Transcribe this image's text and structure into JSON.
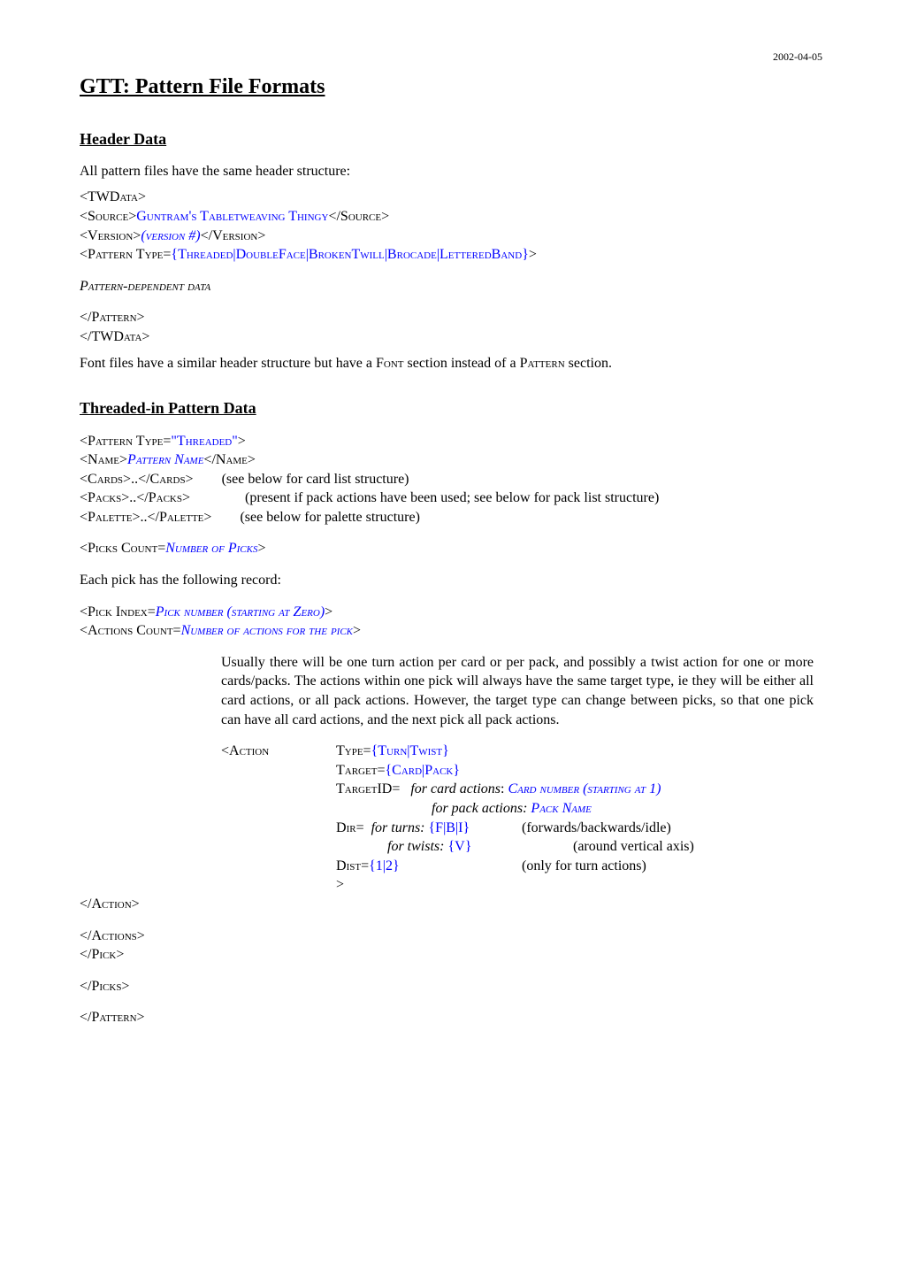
{
  "date": "2002-04-05",
  "title": "GTT: Pattern File Formats",
  "s1": {
    "heading": "Header Data",
    "intro": "All pattern files have the same header structure:",
    "twdata_open": "<TWD",
    "twdata_open2": "ata>",
    "source_open": "<S",
    "source_open2": "ource>",
    "source_val": "Guntram's Tabletweaving Thingy",
    "source_close": "</S",
    "source_close2": "ource>",
    "version_open": "<V",
    "version_open2": "ersion>",
    "version_val": "(version #)",
    "version_close": "</V",
    "version_close2": "ersion>",
    "pattern_open": "<P",
    "pattern_open2": "attern T",
    "pattern_open3": "ype=",
    "pattern_types": "{Threaded|DoubleFace|BrokenTwill|Brocade|LetteredBand}",
    "pdd": "Pattern-dependent data",
    "pattern_close": "</P",
    "pattern_close2": "attern>",
    "twdata_close": "</TWD",
    "twdata_close2": "ata>",
    "font_note_1": "Font files have a similar header structure but have a F",
    "font_note_2": "ont",
    "font_note_3": " section instead of a P",
    "font_note_4": "attern",
    "font_note_5": " section."
  },
  "s2": {
    "heading": "Threaded-in Pattern Data",
    "pattern_open": "<P",
    "pattern_open2": "attern T",
    "pattern_open3": "ype=",
    "pattern_type_val": "\"Threaded\"",
    "name_open": "<N",
    "name_open2": "ame>",
    "name_val": "Pattern Name",
    "name_close": "</N",
    "name_close2": "ame>",
    "cards_open": "<C",
    "cards_open2": "ards>..</C",
    "cards_open3": "ards>",
    "cards_comment": "(see below for card list structure)",
    "packs_open": "<P",
    "packs_open2": "acks>..</P",
    "packs_open3": "acks>",
    "packs_comment": "(present if pack actions have been used; see below for pack list structure)",
    "palette_open": "<P",
    "palette_open2": "alette>..</P",
    "palette_open3": "alette>",
    "palette_comment": "(see below for palette structure)",
    "picks_open": "<P",
    "picks_open2": "icks C",
    "picks_open3": "ount=",
    "picks_val": "Number of Picks",
    "each_pick": "Each pick has the following record:",
    "pick_open": "<P",
    "pick_open2": "ick I",
    "pick_open3": "ndex=",
    "pick_val": "Pick number  (starting at Zero)",
    "actions_open": "<A",
    "actions_open2": "ctions C",
    "actions_open3": "ount=",
    "actions_val": "Number of actions for the pick",
    "usage_para": "Usually there will be one turn action per card or per pack, and possibly a twist action for one or more cards/packs.  The actions within one pick will always have the same target type, ie they will be either all card actions, or all pack actions.   However, the target type can change between picks, so that one pick can have all card actions, and the next pick all pack actions.",
    "action_open": "<A",
    "action_open2": "ction",
    "type_lbl": "T",
    "type_lbl2": "ype=",
    "type_val": "{Turn|Twist}",
    "target_lbl": "T",
    "target_lbl2": "arget=",
    "target_val": "{Card|Pack}",
    "targetid_lbl": "T",
    "targetid_lbl2": "arget",
    "targetid_lbl3": "ID=",
    "targetid_card_pre": "for card actions",
    "targetid_card_colon": ": ",
    "targetid_card_val": "Card number (starting at 1)",
    "targetid_pack_pre": "for pack actions: ",
    "targetid_pack_val": "Pack Name",
    "dir_lbl": "D",
    "dir_lbl2": "ir=",
    "dir_turns_pre": "for turns:",
    "dir_turns_val": "{F|B|I}",
    "dir_turns_comment": "(forwards/backwards/idle)",
    "dir_twists_pre": "for twists:",
    "dir_twists_val": "{V}",
    "dir_twists_comment": "(around vertical axis)",
    "dist_lbl": "D",
    "dist_lbl2": "ist=",
    "dist_val": "{1|2}",
    "dist_comment": "(only for turn actions)",
    "close_angle": ">",
    "action_close": "</A",
    "action_close2": "ction>",
    "actions_close": "</A",
    "actions_close2": "ctions>",
    "pick_close": "</P",
    "pick_close2": "ick>",
    "picks_close": "</P",
    "picks_close2": "icks>",
    "pattern_close": "</P",
    "pattern_close2": "attern>"
  }
}
